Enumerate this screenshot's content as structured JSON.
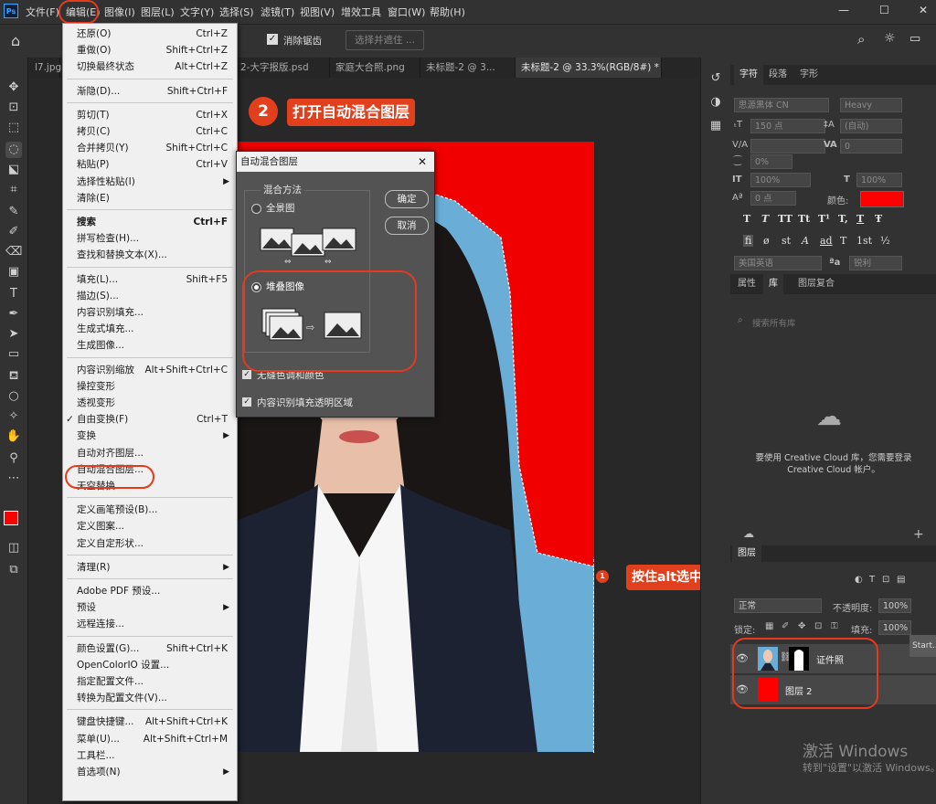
{
  "app": {
    "logo": "Ps"
  },
  "menubar": {
    "items": [
      "文件(F)",
      "编辑(E)",
      "图像(I)",
      "图层(L)",
      "文字(Y)",
      "选择(S)",
      "滤镜(T)",
      "视图(V)",
      "增效工具",
      "窗口(W)",
      "帮助(H)"
    ],
    "window_controls": [
      "—",
      "☐",
      "✕"
    ]
  },
  "optbar": {
    "antialias_label": "消除锯齿",
    "select_mask_button": "选择并遮住 ..."
  },
  "tabs": [
    "l7.jpg",
    "2-大字报版.psd",
    "家庭大合照.png",
    "未标题-2 @ 3...",
    "未标题-2 @ 33.3%(RGB/8#) *"
  ],
  "edit_menu": {
    "groups": [
      [
        {
          "label": "还原(O)",
          "shortcut": "Ctrl+Z"
        },
        {
          "label": "重做(O)",
          "shortcut": "Shift+Ctrl+Z"
        },
        {
          "label": "切换最终状态",
          "shortcut": "Alt+Ctrl+Z"
        }
      ],
      [
        {
          "label": "渐隐(D)...",
          "shortcut": "Shift+Ctrl+F"
        }
      ],
      [
        {
          "label": "剪切(T)",
          "shortcut": "Ctrl+X"
        },
        {
          "label": "拷贝(C)",
          "shortcut": "Ctrl+C"
        },
        {
          "label": "合并拷贝(Y)",
          "shortcut": "Shift+Ctrl+C"
        },
        {
          "label": "粘贴(P)",
          "shortcut": "Ctrl+V"
        },
        {
          "label": "选择性粘贴(I)",
          "shortcut": "",
          "submenu": true
        },
        {
          "label": "清除(E)",
          "shortcut": ""
        }
      ],
      [
        {
          "label": "搜索",
          "shortcut": "Ctrl+F",
          "bold": true
        },
        {
          "label": "拼写检查(H)...",
          "shortcut": ""
        },
        {
          "label": "查找和替换文本(X)...",
          "shortcut": ""
        }
      ],
      [
        {
          "label": "填充(L)...",
          "shortcut": "Shift+F5"
        },
        {
          "label": "描边(S)...",
          "shortcut": ""
        },
        {
          "label": "内容识别填充...",
          "shortcut": ""
        },
        {
          "label": "生成式填充...",
          "shortcut": ""
        },
        {
          "label": "生成图像...",
          "shortcut": ""
        }
      ],
      [
        {
          "label": "内容识别缩放",
          "shortcut": "Alt+Shift+Ctrl+C"
        },
        {
          "label": "操控变形",
          "shortcut": ""
        },
        {
          "label": "透视变形",
          "shortcut": ""
        },
        {
          "label": "自由变换(F)",
          "shortcut": "Ctrl+T",
          "check": true
        },
        {
          "label": "变换",
          "shortcut": "",
          "submenu": true
        },
        {
          "label": "自动对齐图层...",
          "shortcut": ""
        },
        {
          "label": "自动混合图层...",
          "shortcut": ""
        },
        {
          "label": "天空替换...",
          "shortcut": ""
        }
      ],
      [
        {
          "label": "定义画笔预设(B)...",
          "shortcut": ""
        },
        {
          "label": "定义图案...",
          "shortcut": ""
        },
        {
          "label": "定义自定形状...",
          "shortcut": ""
        }
      ],
      [
        {
          "label": "清理(R)",
          "shortcut": "",
          "submenu": true
        }
      ],
      [
        {
          "label": "Adobe PDF 预设...",
          "shortcut": ""
        },
        {
          "label": "预设",
          "shortcut": "",
          "submenu": true
        },
        {
          "label": "远程连接...",
          "shortcut": ""
        }
      ],
      [
        {
          "label": "颜色设置(G)...",
          "shortcut": "Shift+Ctrl+K"
        },
        {
          "label": "OpenColorIO 设置...",
          "shortcut": ""
        },
        {
          "label": "指定配置文件...",
          "shortcut": ""
        },
        {
          "label": "转换为配置文件(V)...",
          "shortcut": ""
        }
      ],
      [
        {
          "label": "键盘快捷键...",
          "shortcut": "Alt+Shift+Ctrl+K"
        },
        {
          "label": "菜单(U)...",
          "shortcut": "Alt+Shift+Ctrl+M"
        },
        {
          "label": "工具栏...",
          "shortcut": ""
        },
        {
          "label": "首选项(N)",
          "shortcut": "",
          "submenu": true
        }
      ]
    ]
  },
  "dialog": {
    "title": "自动混合图层",
    "close": "✕",
    "method_label": "混合方法",
    "option_panorama": "全景图",
    "option_stack": "堆叠图像",
    "ok": "确定",
    "cancel": "取消",
    "check_seamless": "无缝色调和颜色",
    "check_content_fill": "内容识别填充透明区域"
  },
  "annotations": {
    "step2_num": "2",
    "step2_text": "打开自动混合图层",
    "step1_num": "1",
    "step1_text": "按住alt选中两个图层"
  },
  "char_panel": {
    "tabs": [
      "字符",
      "段落",
      "字形"
    ],
    "font_family": "思源黑体 CN",
    "font_style": "Heavy",
    "font_size": "150 点",
    "leading": "(自动)",
    "kerning": "V/A",
    "tracking": "0",
    "scale_pct": "0%",
    "vscale": "100%",
    "hscale": "100%",
    "baseline": "0 点",
    "color_label": "颜色:",
    "color": "#ff0000",
    "type_styles": [
      "T",
      "T",
      "TT",
      "Tt",
      "T¹",
      "T,",
      "T",
      "Ŧ"
    ],
    "opentype": [
      "fi",
      "ø",
      "st",
      "A",
      "ad",
      "T",
      "1st",
      "½"
    ],
    "language": "美国英语",
    "aa": "锐利"
  },
  "library_panel": {
    "tabs": [
      "属性",
      "库",
      "图层复合"
    ],
    "search_placeholder": "搜索所有库",
    "message": "要使用 Creative Cloud 库，您需要登录 Creative Cloud 帐户。"
  },
  "layers_panel": {
    "title": "图层",
    "blend_mode": "正常",
    "opacity_label": "不透明度:",
    "opacity": "100%",
    "lock_label": "锁定:",
    "fill_label": "填充:",
    "fill": "100%",
    "layers": [
      {
        "name": "证件照"
      },
      {
        "name": "图层 2"
      }
    ],
    "tooltip": "Start..."
  },
  "watermark": {
    "line1": "激活 Windows",
    "line2": "转到\"设置\"以激活 Windows。"
  }
}
